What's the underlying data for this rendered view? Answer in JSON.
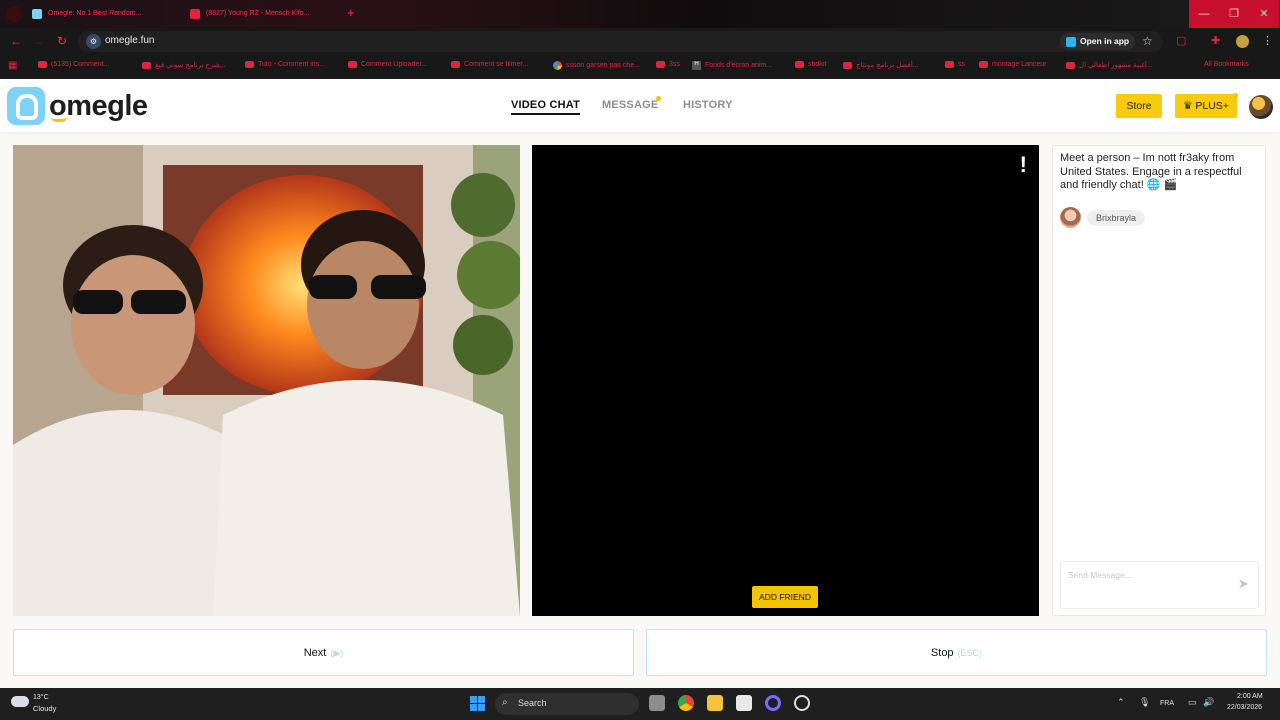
{
  "browser": {
    "tabs": [
      {
        "title": "Omegle: No.1 Best Random..."
      },
      {
        "title": "(8827) Young RZ - Mensch Kifo..."
      }
    ],
    "new_tab": "+",
    "window_controls": {
      "minimize": "—",
      "maximize": "❐",
      "close": "✕"
    },
    "url": "omegle.fun",
    "open_in_app": "Open in app",
    "bookmarks": [
      "(5135) Comment...",
      "شرح برنامج سوني فيغ...",
      "Tuto - Comment ins...",
      "Comment Uploader...",
      "Comment se filmer...",
      "ssson garsen pas che...",
      "3ss",
      "Fonds d'écran anim...",
      "sbdkit",
      "أفضل برنامج مونتاج...",
      "ss",
      "montage Lanceur",
      "أغنية مشهور اطفالي ال..."
    ],
    "all_bookmarks": "All Bookmarks"
  },
  "site": {
    "logo_text": "omegle",
    "nav": {
      "video_chat": "VIDEO CHAT",
      "message": "MESSAGE",
      "history": "HISTORY"
    },
    "store_label": "Store",
    "plus_label": "♛ PLUS+",
    "accent": "#f8cb0f"
  },
  "partner_video": {
    "report_label": "!",
    "add_friend_label": "ADD FRIEND"
  },
  "chat": {
    "intro": "Meet a person – Im nott fr3aky from United States. Engage in a respectful and friendly chat! 🌐 🎬",
    "username": "Brixbrayla",
    "input_placeholder": "Send Message..."
  },
  "controls": {
    "next_label": "Next",
    "next_hint": "(▶)",
    "stop_label": "Stop",
    "stop_hint": "(ESC)"
  },
  "taskbar": {
    "temperature": "13°C",
    "weather": "Cloudy",
    "search_label": "Search",
    "language": "FRA",
    "time": "2:00 AM",
    "date": "22/03/2026"
  }
}
